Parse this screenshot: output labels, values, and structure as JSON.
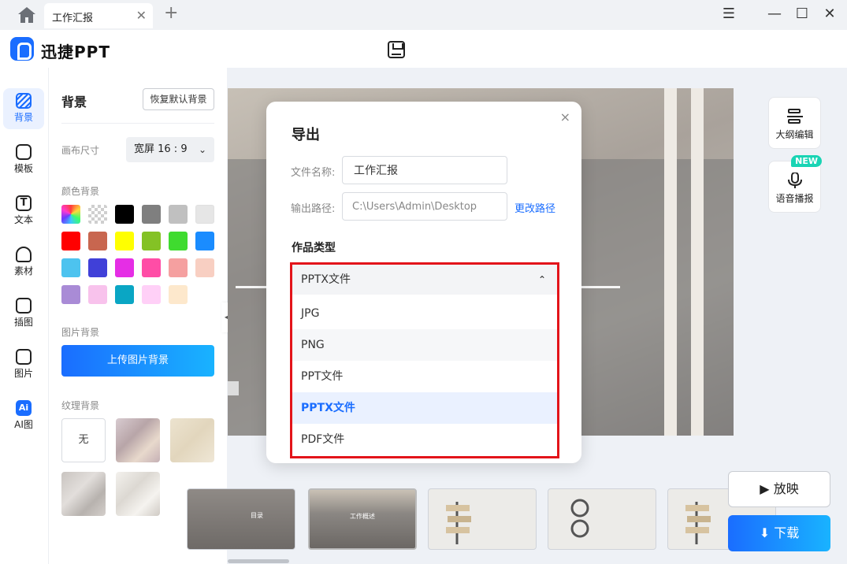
{
  "titlebar": {
    "tab_label": "工作汇报",
    "tab_close": "✕",
    "new_tab": "+",
    "menu": "☰",
    "minimize": "—",
    "maximize": "☐",
    "close": "✕"
  },
  "app": {
    "brand": "迅捷PPT"
  },
  "rail": {
    "items": [
      {
        "label": "背景",
        "icon": "background-icon"
      },
      {
        "label": "模板",
        "icon": "template-icon"
      },
      {
        "label": "文本",
        "icon": "text-icon"
      },
      {
        "label": "素材",
        "icon": "material-icon"
      },
      {
        "label": "插图",
        "icon": "illustration-icon"
      },
      {
        "label": "图片",
        "icon": "image-icon"
      },
      {
        "label": "AI图",
        "icon": "ai-image-icon"
      }
    ],
    "ai_glyph": "Ai",
    "text_glyph": "T"
  },
  "panel": {
    "title": "背景",
    "reset_label": "恢复默认背景",
    "canvas_size_label": "画布尺寸",
    "canvas_size_value": "宽屏 16 : 9",
    "color_bg_label": "颜色背景",
    "colors": [
      "gradient",
      "transparent",
      "#000000",
      "#7f7f7f",
      "#c0c0c0",
      "#e6e6e6",
      "#ff0000",
      "#c8664f",
      "#ffff00",
      "#84c225",
      "#3fdb2f",
      "#1a8cff",
      "#4dc3ef",
      "#4040d8",
      "#e52ee5",
      "#ff4da6",
      "#f5a0a0",
      "#f8cfc2",
      "#a98bd6",
      "#f8c2ec",
      "#0aa6c4",
      "#ffd0f7",
      "#fde8cc"
    ],
    "image_bg_label": "图片背景",
    "upload_label": "上传图片背景",
    "texture_bg_label": "纹理背景",
    "texture_none": "无"
  },
  "side_tools": {
    "outline_label": "大纲编辑",
    "voice_label": "语音播报",
    "new_badge": "NEW"
  },
  "thumbnails": [
    {
      "title": "目录"
    },
    {
      "title": "工作概述"
    },
    {
      "title": ""
    },
    {
      "title": ""
    },
    {
      "title": ""
    }
  ],
  "actions": {
    "play_label": "放映",
    "download_label": "下载"
  },
  "dialog": {
    "title": "导出",
    "close": "×",
    "file_name_label": "文件名称:",
    "file_name_value": "工作汇报",
    "output_path_label": "输出路径:",
    "output_path_value": "C:\\Users\\Admin\\Desktop",
    "change_path": "更改路径",
    "type_title": "作品类型",
    "selected_type": "PPTX文件",
    "options": [
      "JPG",
      "PNG",
      "PPT文件",
      "PPTX文件",
      "PDF文件"
    ],
    "selected_index": 3,
    "highlight_color": "#e3141a"
  }
}
